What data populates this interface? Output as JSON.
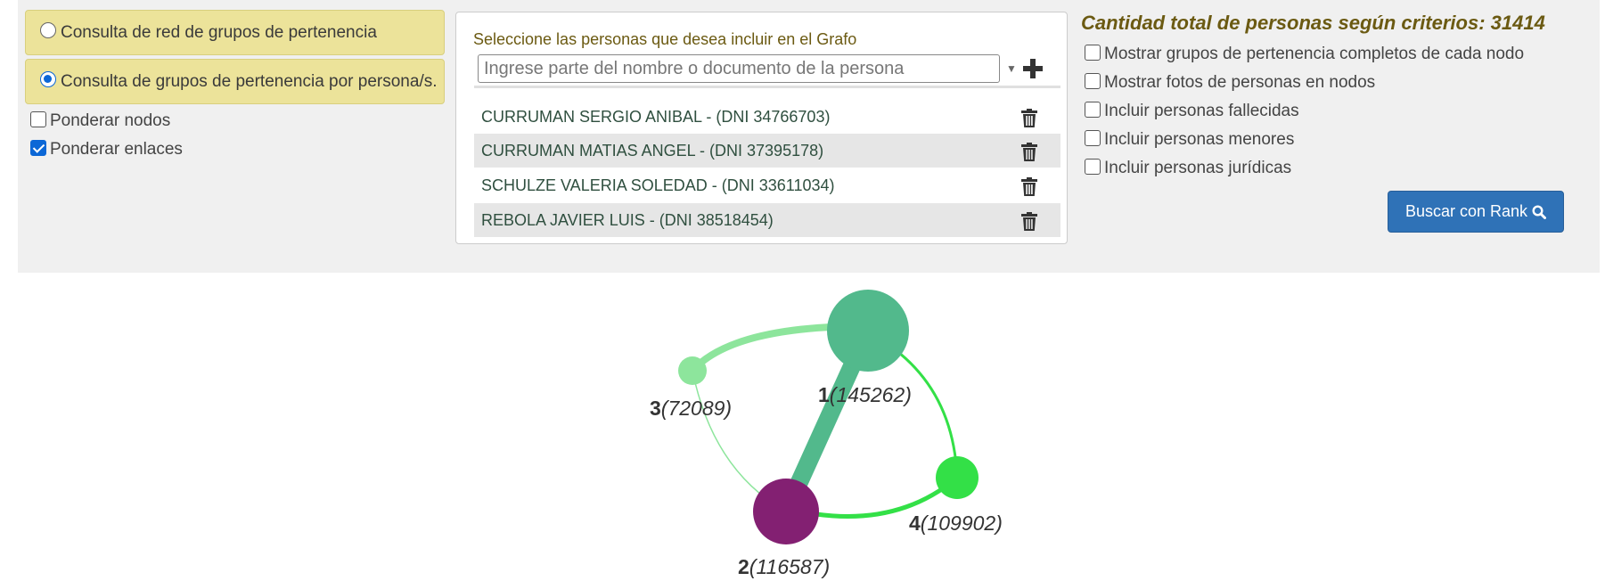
{
  "modes": [
    {
      "label": "Consulta de red de grupos de pertenencia",
      "selected": false
    },
    {
      "label": "Consulta de grupos de pertenencia por persona/s.",
      "selected": true
    }
  ],
  "weights": [
    {
      "label": "Ponderar nodos",
      "checked": false
    },
    {
      "label": "Ponderar enlaces",
      "checked": true
    }
  ],
  "persons": {
    "title": "Seleccione las personas que desea incluir en el Grafo",
    "search_placeholder": "Ingrese parte del nombre o documento de la persona",
    "items": [
      "CURRUMAN SERGIO ANIBAL - (DNI 34766703)",
      "CURRUMAN MATIAS ANGEL - (DNI 37395178)",
      "SCHULZE VALERIA SOLEDAD - (DNI 33611034)",
      "REBOLA JAVIER LUIS - (DNI 38518454)"
    ]
  },
  "criteria": {
    "title": "Cantidad total de personas según criterios:  31414",
    "options": [
      {
        "label": "Mostrar grupos de pertenencia completos de cada nodo",
        "checked": false
      },
      {
        "label": "Mostrar fotos de personas en nodos",
        "checked": false
      },
      {
        "label": "Incluir personas fallecidas",
        "checked": false
      },
      {
        "label": "Incluir personas menores",
        "checked": false
      },
      {
        "label": "Incluir personas jurídicas",
        "checked": false
      }
    ],
    "search_button": "Buscar con Rank"
  },
  "graph": {
    "nodes": [
      {
        "id": "1",
        "value": "(145262)",
        "color": "#52b98c"
      },
      {
        "id": "2",
        "value": "(116587)",
        "color": "#832072"
      },
      {
        "id": "3",
        "value": "(72089)",
        "color": "#8de59c"
      },
      {
        "id": "4",
        "value": "(109902)",
        "color": "#33e047"
      }
    ]
  },
  "colors": {
    "panel_bg": "#f0f0f0",
    "mode_bg": "#ece39a",
    "title_color": "#6b5a12",
    "button_blue": "#2f72b7"
  }
}
